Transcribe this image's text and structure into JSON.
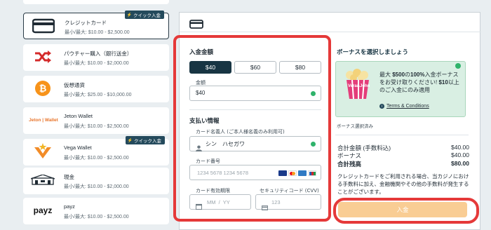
{
  "methods": [
    {
      "name": "クレジットカード",
      "limit": "最小/最大: $10.00 - $2,500.00",
      "badge": "クイック入金",
      "icon": "credit-card-icon"
    },
    {
      "name": "パウチャー購入（銀行送金）",
      "limit": "最小/最大: $10.00 - $2,000.00",
      "icon": "shuffle-icon"
    },
    {
      "name": "仮想通貨",
      "limit": "最小/最大: $25.00 - $10,000.00",
      "icon": "bitcoin-icon"
    },
    {
      "name": "Jeton Wallet",
      "limit": "最小/最大: $10.00 - $2,500.00",
      "logo_text": "Jeton | Wallet",
      "icon": "jeton-logo"
    },
    {
      "name": "Vega Wallet",
      "limit": "最小/最大: $10.00 - $2,500.00",
      "badge": "クイック入金",
      "icon": "vega-logo"
    },
    {
      "name": "現金",
      "limit": "最小/最大: $10.00 - $2,000.00",
      "icon": "cash-store-icon"
    },
    {
      "name": "payz",
      "limit": "最小/最大: $10.00 - $2,500.00",
      "logo_text": "payz",
      "icon": "payz-logo"
    }
  ],
  "deposit_form": {
    "amount_title": "入金金額",
    "amount_options": [
      "$40",
      "$60",
      "$80"
    ],
    "amount_label": "金額",
    "amount_value": "$40",
    "payment_title": "支払い情報",
    "cardholder_label": "カード名義人 (ご本人様名義のみ利用可)",
    "cardholder_value": "シン　ハセガワ",
    "card_number_label": "カード番号",
    "card_number_placeholder": "1234 5678 1234 5678",
    "card_brands": [
      "VISA",
      "MC",
      "AMEX",
      "JCB"
    ],
    "expiry_label": "カード有効期限",
    "expiry_placeholder": "MM  /  YY",
    "cvv_label": "セキュリティコード (CVV)",
    "cvv_placeholder": "123"
  },
  "bonus": {
    "title": "ボーナスを選択しましょう",
    "image_text": "Vera&John",
    "text_pre": "最大 ",
    "text_bold1": "$500",
    "text_mid": "の",
    "text_bold2": "100%",
    "text_rest": "入金ボーナスをお受け取りください! ",
    "text_bold3": "$10",
    "text_end": "以上のご入金にのみ適用",
    "terms_link": "Terms & Conditions",
    "selected_label": "ボーナス選択済み"
  },
  "summary": {
    "deposit_label": "合計金額 (手数料込)",
    "deposit_value": "$40.00",
    "bonus_label": "ボーナス",
    "bonus_value": "$40.00",
    "total_label": "合計残高",
    "total_value": "$80.00"
  },
  "notice": "クレジットカードをご利用される場合、当カジノにおける手数料に加え、金融機関やその他の手数料が発生することがございます。",
  "deposit_button": "入金",
  "colors": {
    "accent_dark": "#183543",
    "badge": "#244a5c",
    "success": "#2fb36b",
    "highlight": "#e53939",
    "button": "#f9cd94"
  }
}
